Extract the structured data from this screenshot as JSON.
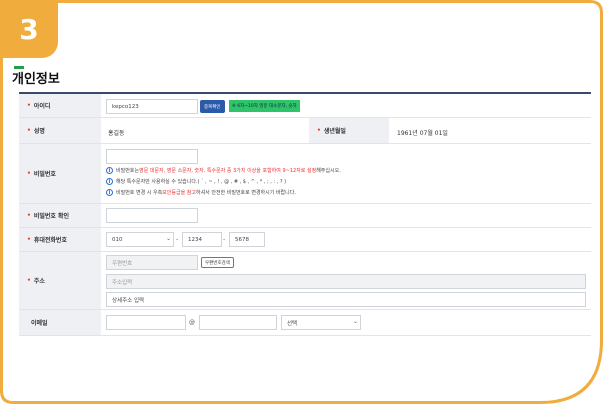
{
  "badge": {
    "number": "3"
  },
  "section": {
    "title": "개인정보"
  },
  "colors": {
    "accent": "#f1ac3e",
    "green": "#1ea14a",
    "header_line": "#3a4a6b",
    "required": "#e33333"
  },
  "fields": {
    "id": {
      "label": "아이디",
      "value": "kepco123",
      "button": "중복확인",
      "tag": "※ 6자~10자 영문 대소문자, 숫자"
    },
    "name": {
      "label": "성명",
      "value": "홍길동"
    },
    "birth": {
      "label": "생년월일",
      "value": "1961년 07월 01일"
    },
    "password": {
      "label": "비밀번호",
      "hint1_pre": "비밀번호는 ",
      "hint1_red": "영문 대문자, 영문 소문자, 숫자, 특수문자 중 3가지 이상을 포함하여 9~12자로 설정",
      "hint1_post": "해주십시오.",
      "hint2": "해당 특수문자만 사용하실 수 있습니다.(  ` , ~ , ! , @ , # , $ , ^ , * , ; , : , ? )",
      "hint3_pre": "비밀번호 변경 시 우측 ",
      "hint3_red": "보안등급을 참고",
      "hint3_post": "하셔서 안전한 비밀번호로 변경하시기 바랍니다."
    },
    "password_confirm": {
      "label": "비밀번호 확인"
    },
    "mobile": {
      "label": "휴대전화번호",
      "part1": "010",
      "part2": "1234",
      "part3": "5678",
      "dash": "-"
    },
    "address": {
      "label": "주소",
      "zip_placeholder": "우편번호",
      "search_button": "우편번호검색",
      "addr_placeholder": "주소입력",
      "detail_placeholder": "상세주소 입력"
    },
    "email": {
      "label": "이메일",
      "at": "@",
      "select": "선택"
    }
  }
}
